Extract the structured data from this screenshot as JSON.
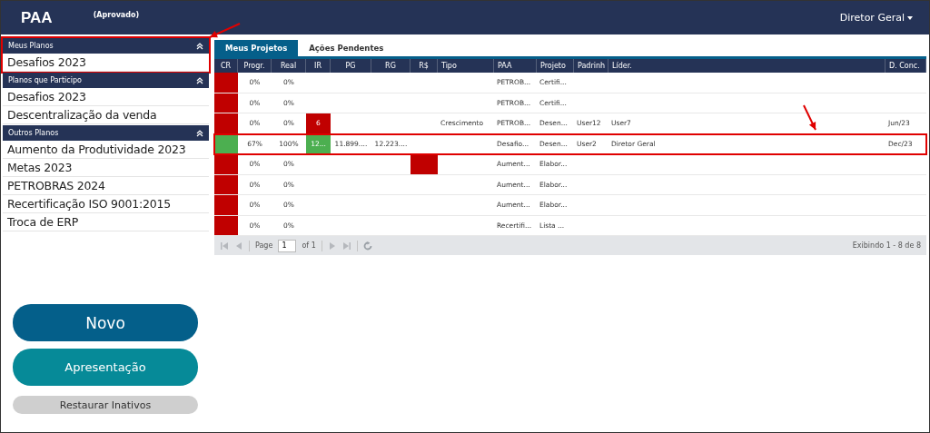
{
  "header": {
    "title": "PAA",
    "status": "(Aprovado)",
    "user_menu": "Diretor Geral"
  },
  "sidebar": {
    "sections": [
      {
        "title": "Meus Planos",
        "expanded": true,
        "highlighted": true,
        "items": [
          "Desafios 2023"
        ]
      },
      {
        "title": "Planos que Participo",
        "expanded": true,
        "highlighted": false,
        "items": [
          "Desafios 2023",
          "Descentralização da venda"
        ]
      },
      {
        "title": "Outros Planos",
        "expanded": true,
        "highlighted": false,
        "items": [
          "Aumento da Produtividade 2023",
          "Metas 2023",
          "PETROBRAS 2024",
          "Recertificação ISO 9001:2015",
          "Troca de ERP"
        ]
      }
    ],
    "buttons": [
      {
        "label": "Novo",
        "kind": "primary"
      },
      {
        "label": "Apresentação",
        "kind": "secondary"
      },
      {
        "label": "Restaurar Inativos",
        "kind": "muted"
      }
    ]
  },
  "tabs": [
    {
      "label": "Meus Projetos",
      "selected": true
    },
    {
      "label": "Ações Pendentes",
      "selected": false
    }
  ],
  "table": {
    "columns": [
      "CR",
      "Progr.",
      "Real",
      "IR",
      "PG",
      "RG",
      "R$",
      "Tipo",
      "PAA",
      "Projeto",
      "Padrinh",
      "Líder.",
      "D. Conc."
    ],
    "rows": [
      {
        "highlighted": false,
        "cells": [
          {
            "color": "#c00000"
          },
          {
            "text": "0%"
          },
          {
            "text": "0%"
          },
          {},
          {},
          {},
          {},
          {},
          {
            "text": "PETROB..."
          },
          {
            "text": "Certifi..."
          },
          {},
          {},
          {}
        ]
      },
      {
        "highlighted": false,
        "cells": [
          {
            "color": "#c00000"
          },
          {
            "text": "0%"
          },
          {
            "text": "0%"
          },
          {},
          {},
          {},
          {},
          {},
          {
            "text": "PETROB..."
          },
          {
            "text": "Certifi..."
          },
          {},
          {},
          {}
        ]
      },
      {
        "highlighted": false,
        "cells": [
          {
            "color": "#c00000"
          },
          {
            "text": "0%"
          },
          {
            "text": "0%"
          },
          {
            "text": "6",
            "color": "#c00000"
          },
          {},
          {},
          {},
          {
            "text": "Crescimento"
          },
          {
            "text": "PETROB..."
          },
          {
            "text": "Desen..."
          },
          {
            "text": "User12"
          },
          {
            "text": "User7"
          },
          {
            "text": "Jun/23"
          }
        ]
      },
      {
        "highlighted": true,
        "cells": [
          {
            "color": "#4caf50"
          },
          {
            "text": "67%"
          },
          {
            "text": "100%"
          },
          {
            "text": "12...",
            "color": "#4caf50"
          },
          {
            "text": "11.899...."
          },
          {
            "text": "12.223...."
          },
          {},
          {},
          {
            "text": "Desafio..."
          },
          {
            "text": "Desen..."
          },
          {
            "text": "User2"
          },
          {
            "text": "Diretor Geral"
          },
          {
            "text": "Dec/23"
          }
        ]
      },
      {
        "highlighted": false,
        "cells": [
          {
            "color": "#c00000"
          },
          {
            "text": "0%"
          },
          {
            "text": "0%"
          },
          {},
          {},
          {},
          {
            "color": "#c00000"
          },
          {},
          {
            "text": "Aument..."
          },
          {
            "text": "Elabor..."
          },
          {},
          {},
          {}
        ]
      },
      {
        "highlighted": false,
        "cells": [
          {
            "color": "#c00000"
          },
          {
            "text": "0%"
          },
          {
            "text": "0%"
          },
          {},
          {},
          {},
          {},
          {},
          {
            "text": "Aument..."
          },
          {
            "text": "Elabor..."
          },
          {},
          {},
          {}
        ]
      },
      {
        "highlighted": false,
        "cells": [
          {
            "color": "#c00000"
          },
          {
            "text": "0%"
          },
          {
            "text": "0%"
          },
          {},
          {},
          {},
          {},
          {},
          {
            "text": "Aument..."
          },
          {
            "text": "Elabor..."
          },
          {},
          {},
          {}
        ]
      },
      {
        "highlighted": false,
        "cells": [
          {
            "color": "#c00000"
          },
          {
            "text": "0%"
          },
          {
            "text": "0%"
          },
          {},
          {},
          {},
          {},
          {},
          {
            "text": "Recertifi..."
          },
          {
            "text": "Lista ..."
          },
          {},
          {},
          {}
        ]
      }
    ]
  },
  "pager": {
    "page_label": "Page",
    "page": "1",
    "of": "of 1",
    "summary": "Exibindo 1 - 8 de 8"
  }
}
